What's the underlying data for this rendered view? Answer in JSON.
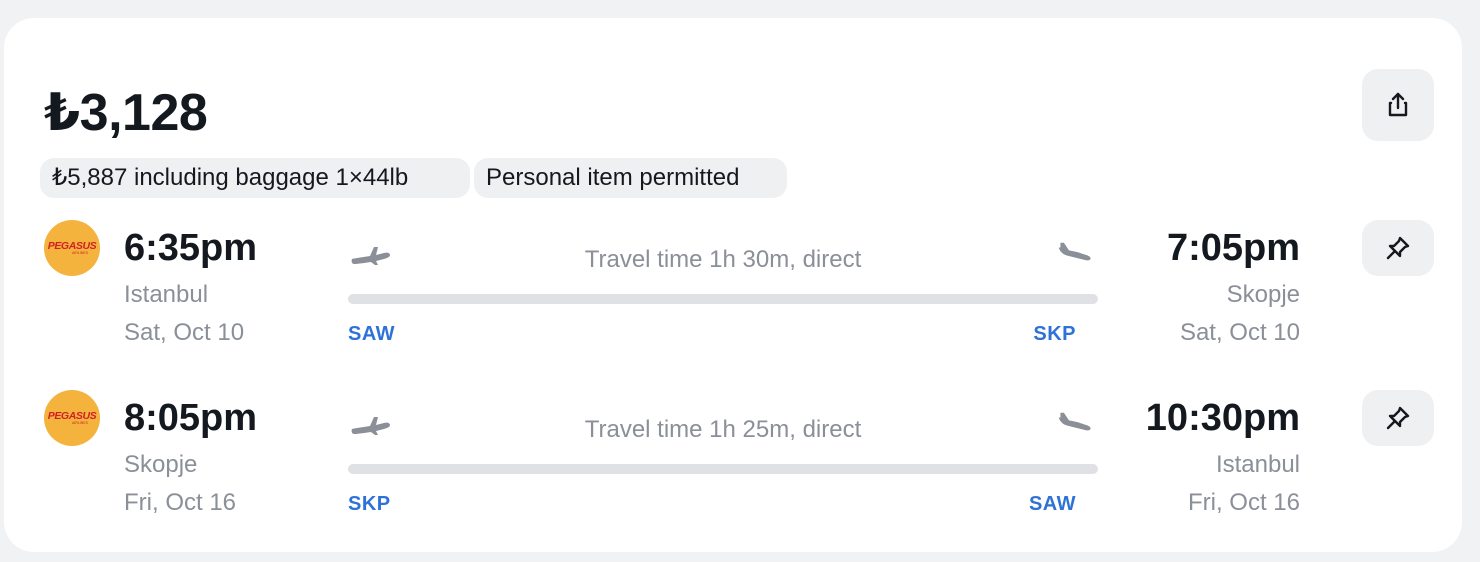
{
  "price": "₺3,128",
  "pills": {
    "baggage": "₺5,887 including baggage 1×44lb",
    "personal_item": "Personal item permitted"
  },
  "airline": {
    "name": "PEGASUS",
    "subtitle": "AIRLINES",
    "logo_color": "#f3b33d",
    "logo_text_color": "#d21f26"
  },
  "icons": {
    "share": "share-icon",
    "pin": "pin-icon",
    "takeoff": "plane-takeoff-icon",
    "landing": "plane-landing-icon"
  },
  "colors": {
    "accent_code": "#2e72d8",
    "muted_text": "#8a8f98",
    "bar": "#dfe1e5"
  },
  "segments": [
    {
      "dep_time": "6:35pm",
      "dep_city": "Istanbul",
      "dep_date": "Sat, Oct 10",
      "arr_time": "7:05pm",
      "arr_city": "Skopje",
      "arr_date": "Sat, Oct 10",
      "travel_time": "Travel time 1h 30m, direct",
      "from_code": "SAW",
      "to_code": "SKP"
    },
    {
      "dep_time": "8:05pm",
      "dep_city": "Skopje",
      "dep_date": "Fri, Oct 16",
      "arr_time": "10:30pm",
      "arr_city": "Istanbul",
      "arr_date": "Fri, Oct 16",
      "travel_time": "Travel time 1h 25m, direct",
      "from_code": "SKP",
      "to_code": "SAW"
    }
  ]
}
